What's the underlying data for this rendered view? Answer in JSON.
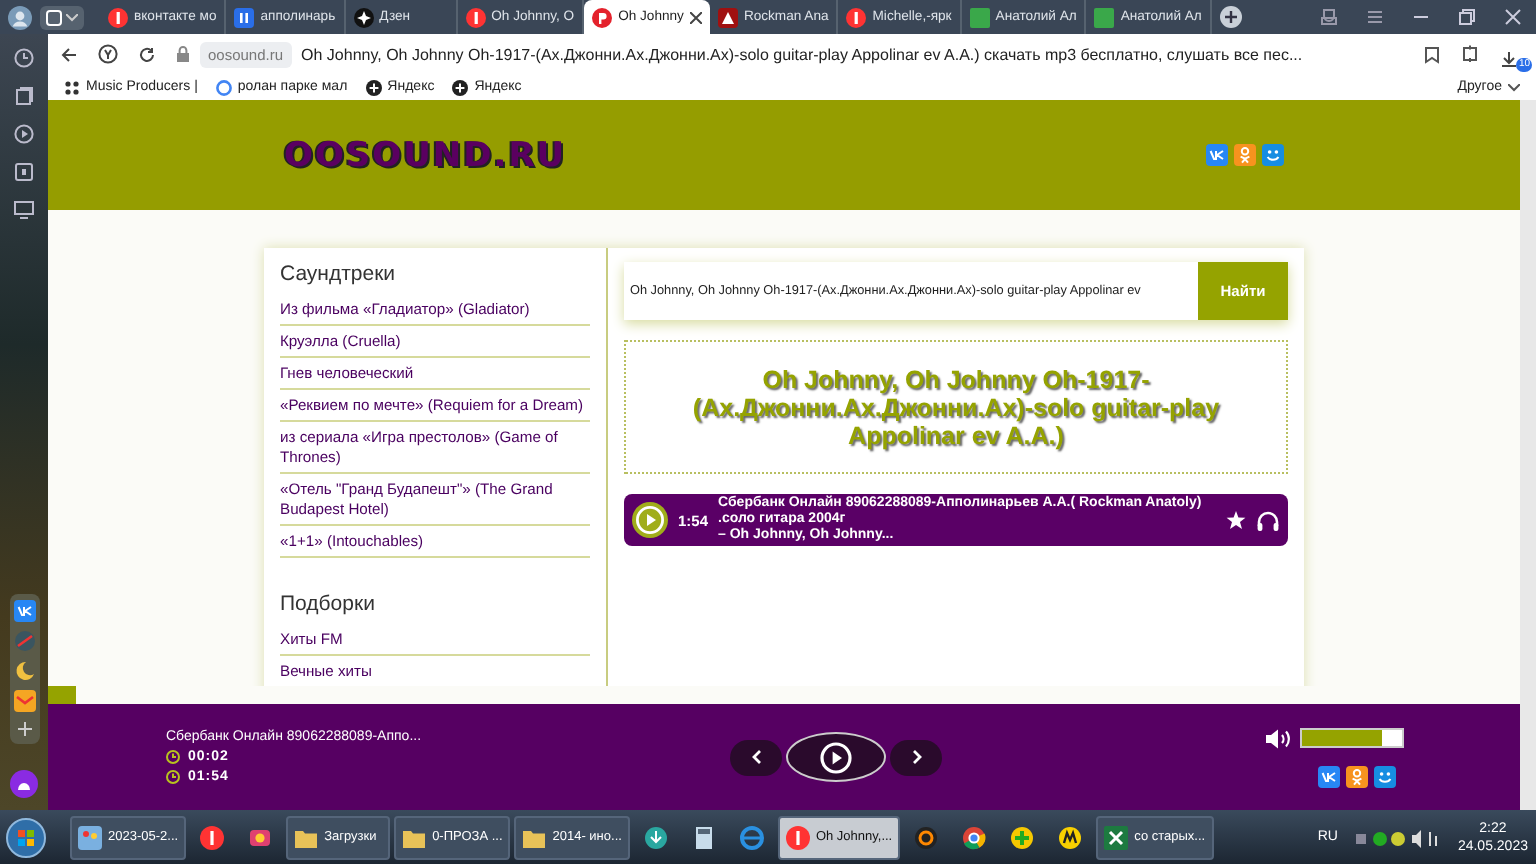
{
  "browser": {
    "tabs": [
      {
        "label": "вконтакте мо",
        "kind": "ya",
        "selected": false
      },
      {
        "label": "апполинарь",
        "kind": "pause",
        "selected": false
      },
      {
        "label": "Дзен",
        "kind": "zen",
        "selected": false
      },
      {
        "label": "Oh Johnny, O",
        "kind": "ya",
        "selected": false
      },
      {
        "label": "Oh Johnny",
        "kind": "p",
        "selected": true
      },
      {
        "label": "Rockman Ana",
        "kind": "rock",
        "selected": false
      },
      {
        "label": "Michelle,-ярк",
        "kind": "ya",
        "selected": false
      },
      {
        "label": "Анатолий Ал",
        "kind": "sheet",
        "selected": false
      },
      {
        "label": "Анатолий Ал",
        "kind": "sheet",
        "selected": false
      }
    ],
    "address": {
      "domain": "oosound.ru",
      "title": "Oh Johnny, Oh Johnny Oh-1917-(Ах.Джонни.Ах.Джонни.Ах)-solo guitar-play Appolinar ev A.A.) скачать mp3 бесплатно, слушать все пес..."
    },
    "downloads_badge": "10",
    "bookmarks": [
      {
        "label": "Music Producers |",
        "kind": "dots"
      },
      {
        "label": "ролан парке мал",
        "kind": "g"
      },
      {
        "label": "Яндекс",
        "kind": "plus"
      },
      {
        "label": "Яндекс",
        "kind": "plus"
      }
    ],
    "other_bookmarks": "Другое"
  },
  "site": {
    "logo": "OOSOUND.RU",
    "search": {
      "value": "Oh Johnny, Oh Johnny Oh-1917-(Ах.Джонни.Ах.Джонни.Ах)-solo guitar-play Appolinar ev",
      "button": "Найти"
    },
    "sections": [
      {
        "heading": "Саундтреки",
        "items": [
          "Из фильма «Гладиатор» (Gladiator)",
          "Круэлла (Cruella)",
          "Гнев человеческий",
          "«Реквием по мечте» (Requiem for a Dream)",
          "из сериала «Игра престолов» (Game of Thrones)",
          "«Отель \"Гранд Будапешт\"» (The Grand Budapest Hotel)",
          "«1+1» (Intouchables)"
        ]
      },
      {
        "heading": "Подборки",
        "items": [
          "Хиты FM",
          "Вечные хиты"
        ]
      }
    ],
    "title": "Oh Johnny, Oh Johnny Oh-1917-(Ах.Джонни.Ах.Джонни.Ах)-solo guitar-play Appolinar ev A.A.)",
    "tracks": [
      {
        "duration": "1:54",
        "title_lines": [
          "Сбербанк Онлайн 89062288089-Апполинарьев А.А.( Rockman Anatoly)",
          ".соло гитара 2004г"
        ],
        "artist": "– Oh Johnny, Oh Johnny..."
      }
    ]
  },
  "player": {
    "now_playing": "Сбербанк Онлайн 89062288089-Аппо...",
    "elapsed": "00:02",
    "duration": "01:54",
    "volume": {
      "level": 0.8
    }
  },
  "taskbar": {
    "items": [
      {
        "kind": "start"
      },
      {
        "kind": "paint",
        "label": "2023-05-2...",
        "selected": false
      },
      {
        "kind": "ya",
        "selected": false
      },
      {
        "kind": "colors",
        "selected": false
      },
      {
        "kind": "folder",
        "label": "Загрузки",
        "selected": false
      },
      {
        "kind": "folder",
        "label": "0-ПРОЗА ...",
        "selected": false
      },
      {
        "kind": "folder",
        "label": "2014- ино...",
        "selected": false
      },
      {
        "kind": "down",
        "selected": false
      },
      {
        "kind": "calc",
        "selected": false
      },
      {
        "kind": "ie",
        "selected": false
      },
      {
        "kind": "ya",
        "label": "Oh Johnny,...",
        "selected": true
      },
      {
        "kind": "game",
        "selected": false
      },
      {
        "kind": "chrome",
        "selected": false
      },
      {
        "kind": "plus",
        "selected": false
      },
      {
        "kind": "m",
        "selected": false
      },
      {
        "kind": "excel",
        "label": "со старых...",
        "selected": false
      }
    ],
    "language": "RU",
    "time": "2:22",
    "date": "24.05.2023"
  }
}
